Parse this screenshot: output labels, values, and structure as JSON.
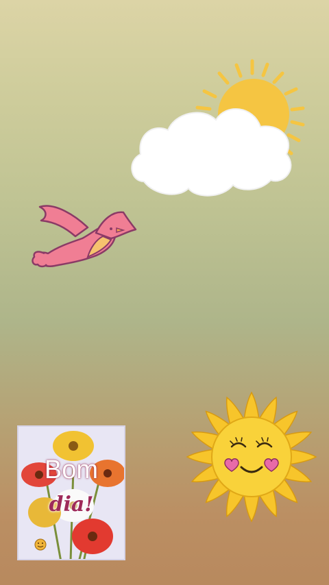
{
  "sticker": {
    "line1": "Bom",
    "line2": "dia!"
  },
  "colors": {
    "background_top": "#dcd4a6",
    "background_bottom": "#b8895e",
    "sun_yellow": "#f5c542",
    "cloud_white": "#ffffff",
    "bird_pink": "#f07e94",
    "bird_outline": "#8a3a66",
    "heart_pink": "#e86aa8",
    "greeting_text": "#9e2a5a"
  },
  "icons": [
    "sun-icon",
    "cloud-icon",
    "bird-icon",
    "smiling-sun-icon",
    "flower-bouquet-image"
  ]
}
